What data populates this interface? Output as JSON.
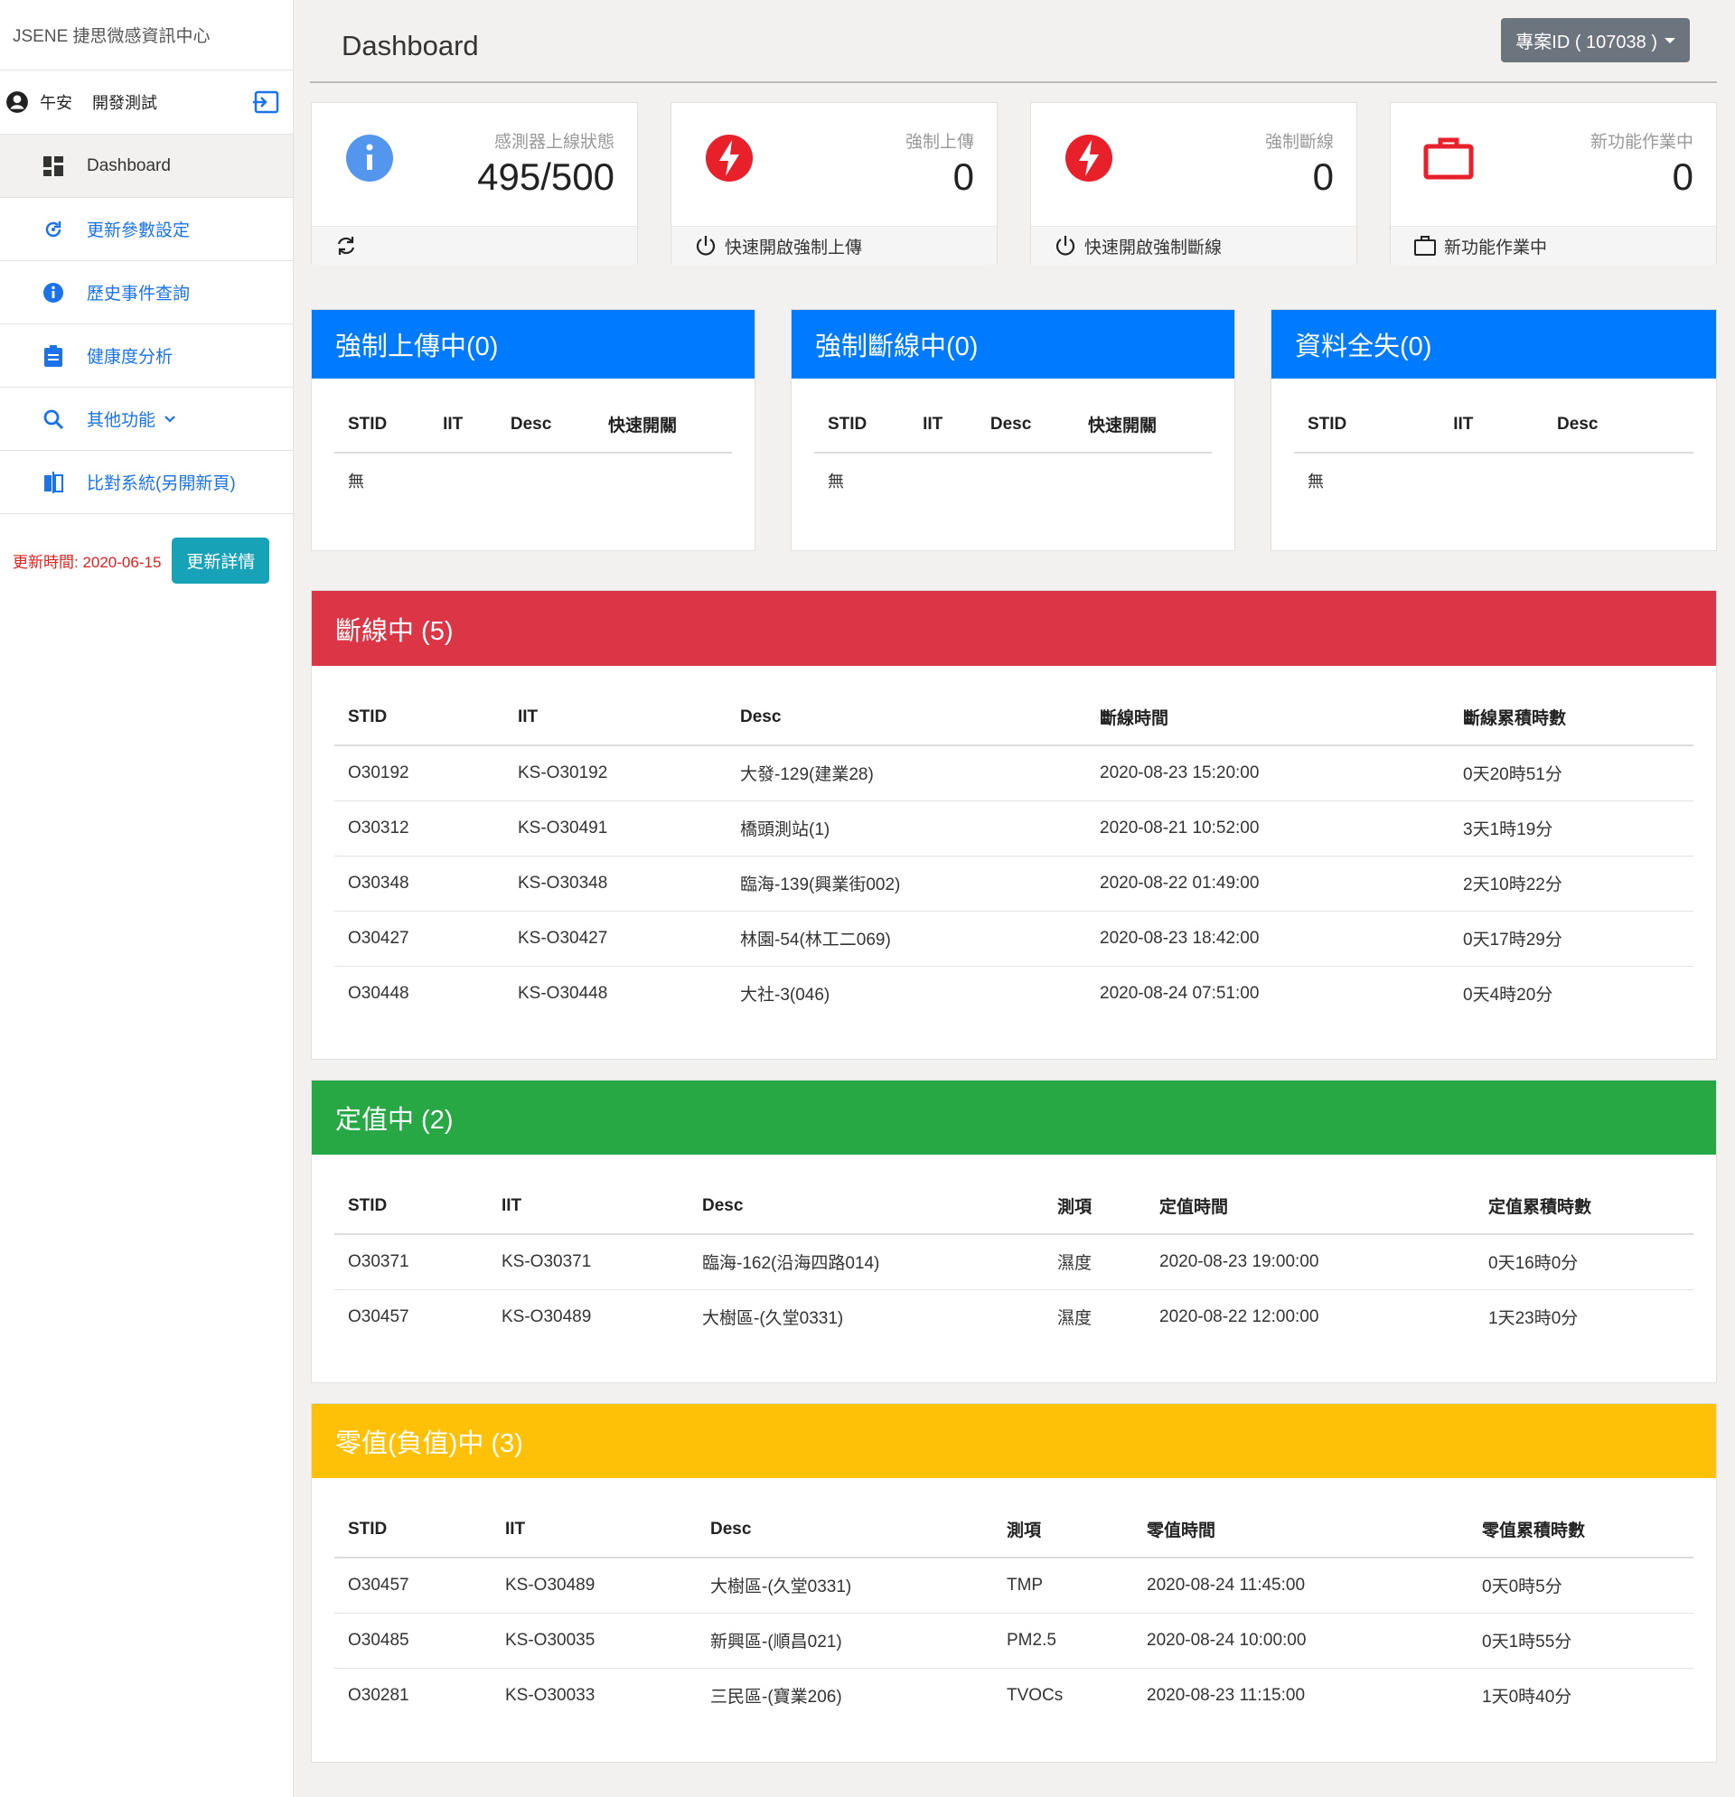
{
  "brand": "JSENE 捷思微感資訊中心",
  "user": {
    "greeting": "午安",
    "name": "開發測試"
  },
  "sidebar": {
    "items": [
      {
        "label": "Dashboard",
        "icon": "dashboard-icon",
        "active": true
      },
      {
        "label": "更新參數設定",
        "icon": "refresh-icon"
      },
      {
        "label": "歷史事件查詢",
        "icon": "info-icon"
      },
      {
        "label": "健康度分析",
        "icon": "clipboard-icon"
      },
      {
        "label": "其他功能",
        "icon": "search-icon",
        "dropdown": true
      },
      {
        "label": "比對系統(另開新頁)",
        "icon": "compare-icon"
      }
    ],
    "update_text": "更新時間: 2020-06-15",
    "update_button": "更新詳情"
  },
  "header": {
    "title": "Dashboard",
    "project_button": "專案ID ( 107038 )"
  },
  "stats": [
    {
      "label": "感測器上線狀態",
      "value": "495/500",
      "icon": "info-circle-icon",
      "color": "#1a73e8",
      "footer": ""
    },
    {
      "label": "強制上傳",
      "value": "0",
      "icon": "lightning-icon",
      "color": "#e8202a",
      "footer": "快速開啟強制上傳"
    },
    {
      "label": "強制斷線",
      "value": "0",
      "icon": "lightning-icon",
      "color": "#e8202a",
      "footer": "快速開啟強制斷線"
    },
    {
      "label": "新功能作業中",
      "value": "0",
      "icon": "briefcase-icon",
      "color": "#e8202a",
      "footer": "新功能作業中"
    }
  ],
  "small_panels": [
    {
      "title": "強制上傳中(0)",
      "columns": [
        "STID",
        "IIT",
        "Desc",
        "快速開關"
      ],
      "empty": "無"
    },
    {
      "title": "強制斷線中(0)",
      "columns": [
        "STID",
        "IIT",
        "Desc",
        "快速開關"
      ],
      "empty": "無"
    },
    {
      "title": "資料全失(0)",
      "columns": [
        "STID",
        "IIT",
        "Desc"
      ],
      "empty": "無"
    }
  ],
  "offline": {
    "title": "斷線中 (5)",
    "columns": [
      "STID",
      "IIT",
      "Desc",
      "斷線時間",
      "斷線累積時數"
    ],
    "rows": [
      [
        "O30192",
        "KS-O30192",
        "大發-129(建業28)",
        "2020-08-23 15:20:00",
        "0天20時51分"
      ],
      [
        "O30312",
        "KS-O30491",
        "橋頭測站(1)",
        "2020-08-21 10:52:00",
        "3天1時19分"
      ],
      [
        "O30348",
        "KS-O30348",
        "臨海-139(興業街002)",
        "2020-08-22 01:49:00",
        "2天10時22分"
      ],
      [
        "O30427",
        "KS-O30427",
        "林園-54(林工二069)",
        "2020-08-23 18:42:00",
        "0天17時29分"
      ],
      [
        "O30448",
        "KS-O30448",
        "大社-3(046)",
        "2020-08-24 07:51:00",
        "0天4時20分"
      ]
    ]
  },
  "constant": {
    "title": "定值中 (2)",
    "columns": [
      "STID",
      "IIT",
      "Desc",
      "測項",
      "定值時間",
      "定值累積時數"
    ],
    "rows": [
      [
        "O30371",
        "KS-O30371",
        "臨海-162(沿海四路014)",
        "濕度",
        "2020-08-23 19:00:00",
        "0天16時0分"
      ],
      [
        "O30457",
        "KS-O30489",
        "大樹區-(久堂0331)",
        "濕度",
        "2020-08-22 12:00:00",
        "1天23時0分"
      ]
    ]
  },
  "zero": {
    "title": "零值(負值)中 (3)",
    "columns": [
      "STID",
      "IIT",
      "Desc",
      "測項",
      "零值時間",
      "零值累積時數"
    ],
    "rows": [
      [
        "O30457",
        "KS-O30489",
        "大樹區-(久堂0331)",
        "TMP",
        "2020-08-24 11:45:00",
        "0天0時5分"
      ],
      [
        "O30485",
        "KS-O30035",
        "新興區-(順昌021)",
        "PM2.5",
        "2020-08-24 10:00:00",
        "0天1時55分"
      ],
      [
        "O30281",
        "KS-O30033",
        "三民區-(寶業206)",
        "TVOCs",
        "2020-08-23 11:15:00",
        "1天0時40分"
      ]
    ]
  }
}
